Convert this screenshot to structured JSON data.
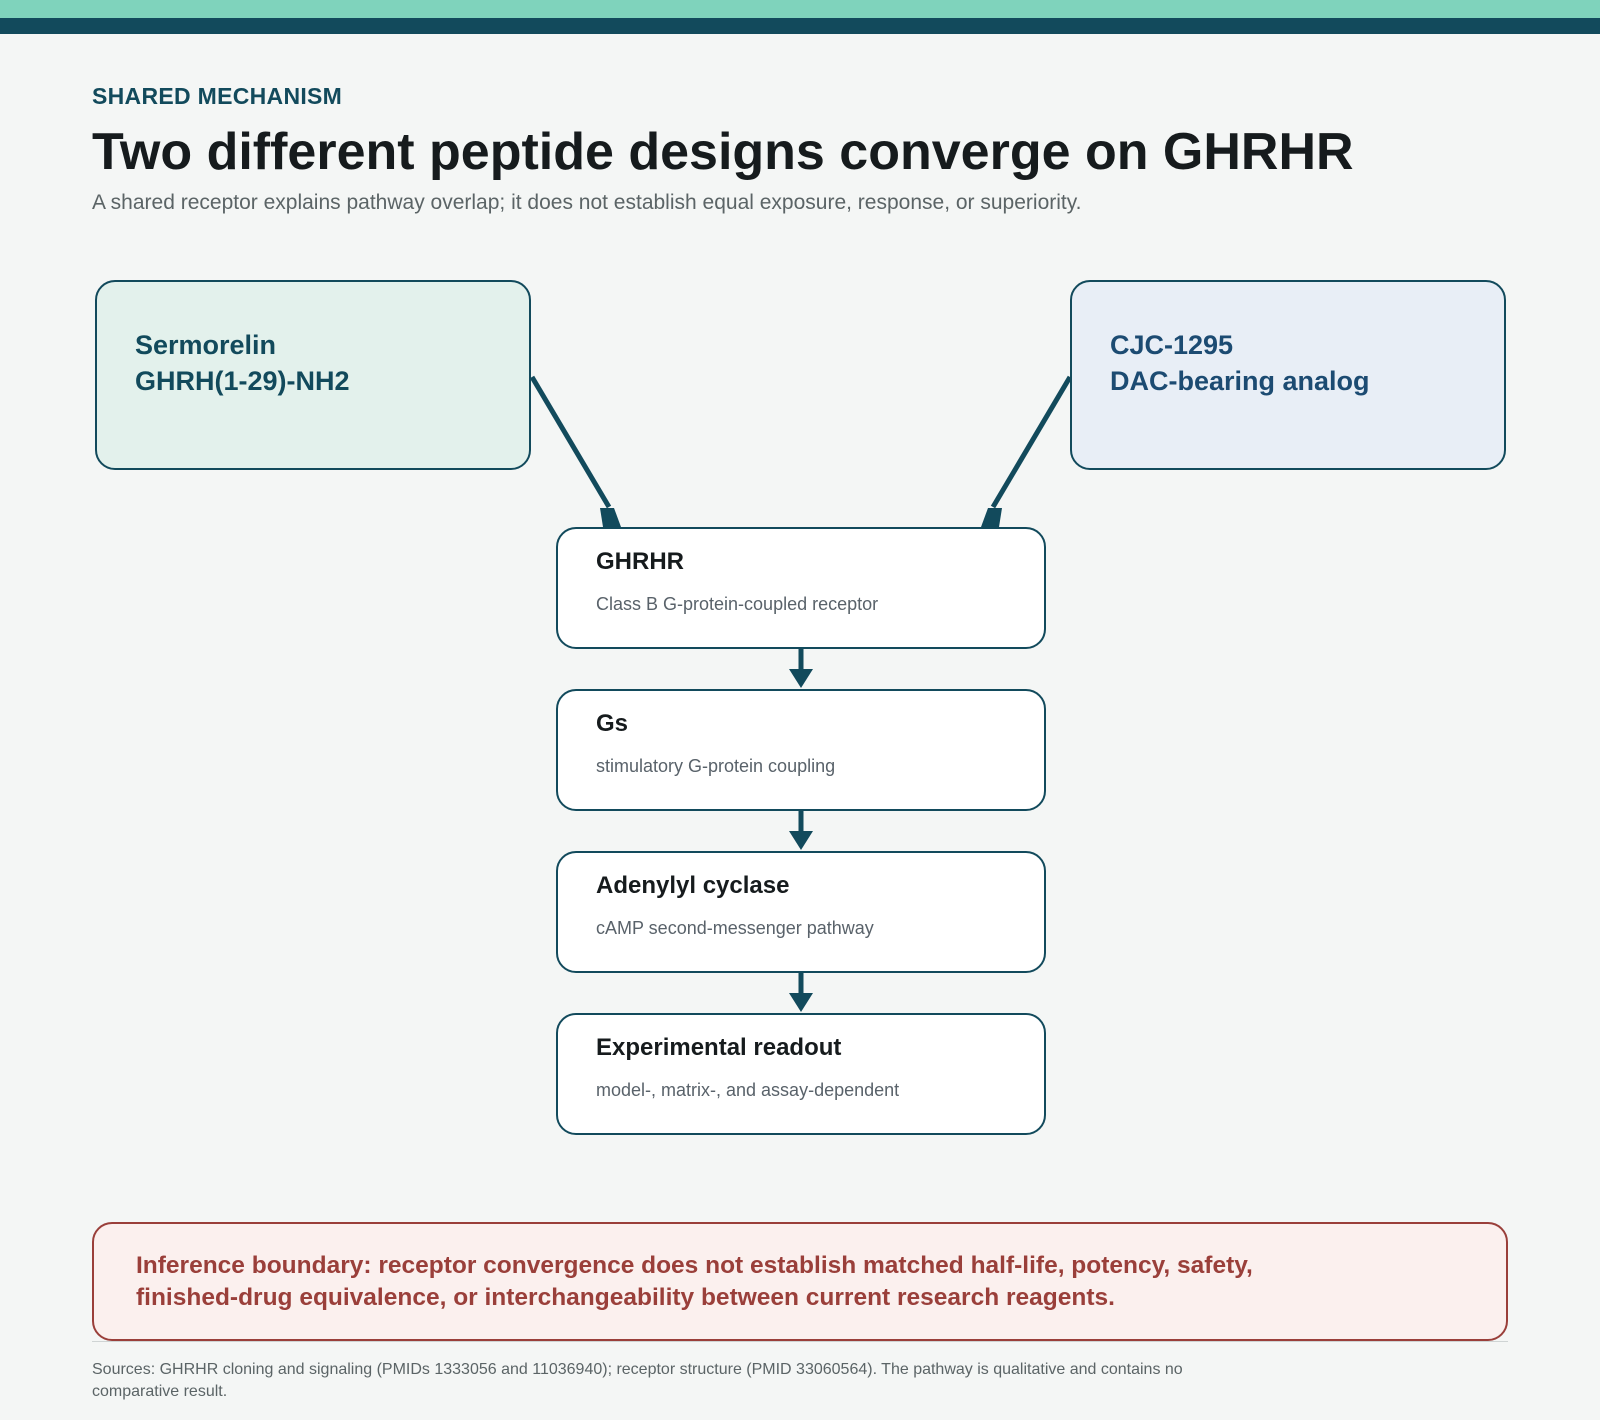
{
  "header": {
    "eyebrow": "SHARED MECHANISM",
    "title": "Two different peptide designs converge on GHRHR",
    "subtitle": "A shared receptor explains pathway overlap; it does not establish equal exposure, response, or superiority."
  },
  "sources_nodes": [
    {
      "line1": "Sermorelin",
      "line2": "GHRH(1-29)-NH2"
    },
    {
      "line1": "CJC-1295",
      "line2": "DAC-bearing analog"
    }
  ],
  "pathway": [
    {
      "title": "GHRHR",
      "desc": "Class B G-protein-coupled receptor"
    },
    {
      "title": "Gs",
      "desc": "stimulatory G-protein coupling"
    },
    {
      "title": "Adenylyl cyclase",
      "desc": "cAMP second-messenger pathway"
    },
    {
      "title": "Experimental readout",
      "desc": "model-, matrix-, and assay-dependent"
    }
  ],
  "boundary": {
    "text": "Inference boundary: receptor convergence does not establish matched half-life, potency, safety, finished-drug equivalence, or interchangeability between current research reagents."
  },
  "footer": {
    "sources": "Sources: GHRHR cloning and signaling (PMIDs 1333056 and 11036940); receptor structure (PMID 33060564). The pathway is qualitative and contains no comparative result."
  },
  "colors": {
    "accent_teal": "#7fd3bc",
    "accent_dark": "#124a5c",
    "warning": "#9a3f3a"
  }
}
